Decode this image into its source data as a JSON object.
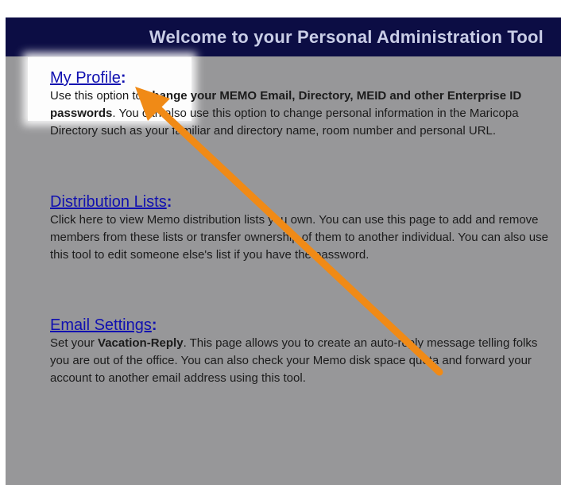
{
  "header": {
    "title": "Welcome to your Personal Administration Tool"
  },
  "sections": [
    {
      "link": "My Profile",
      "colon": ":",
      "body_1": "Use this option to ",
      "body_bold_1": "change your MEMO Email, Directory, MEID and other Enterprise ID passwords",
      "body_2": ". You can also use this option to change personal information in the Maricopa Directory such as your familiar and directory name, room number and personal URL."
    },
    {
      "link": "Distribution Lists",
      "colon": ":",
      "body_1": "Click here to view Memo distribution lists you own. You can use this page to add and remove members from these lists or transfer ownership of them to another individual. You can also use this tool to edit someone else's list if you have the password."
    },
    {
      "link": "Email Settings",
      "colon": ":",
      "body_1": "Set your ",
      "body_bold_1": "Vacation-Reply",
      "body_2": ". This page allows you to create an auto-reply message telling folks you are out of the office. You can also check your Memo disk space quota and forward your account to another email address using this tool."
    }
  ],
  "colors": {
    "header_bg": "#0c0d44",
    "panel_bg": "#979799",
    "link": "#1010b0",
    "arrow": "#f08a16"
  },
  "icons": {
    "annotation_arrow": "arrow-icon"
  }
}
